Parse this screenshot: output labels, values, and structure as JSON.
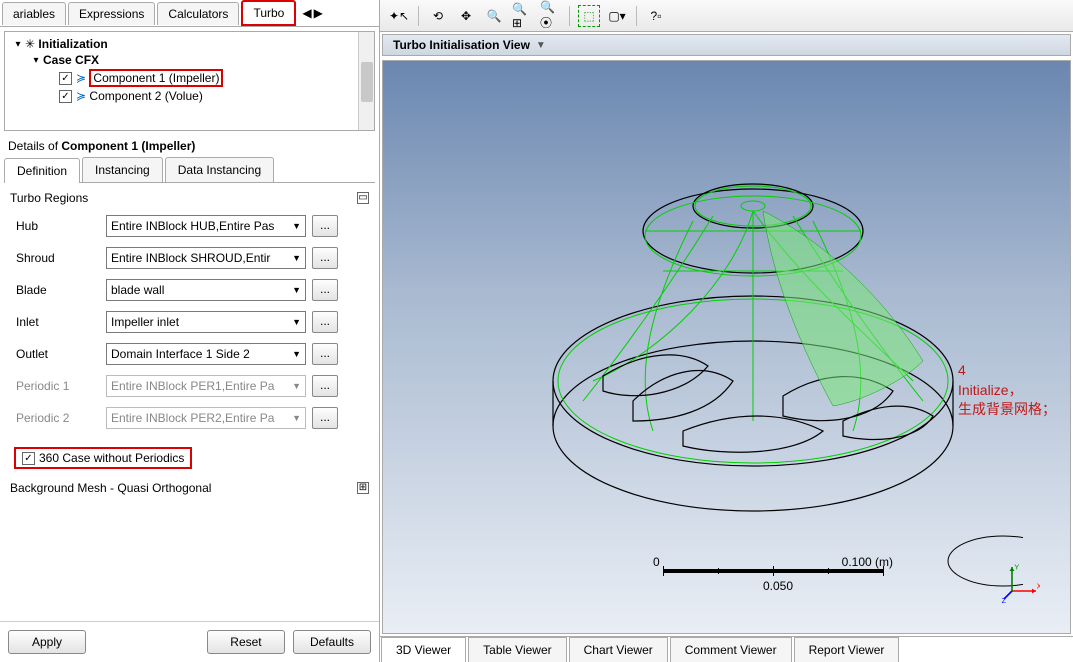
{
  "top_tabs": {
    "t0": "ariables",
    "t1": "Expressions",
    "t2": "Calculators",
    "t3": "Turbo"
  },
  "tree": {
    "root": "Initialization",
    "case": "Case CFX",
    "comp1": "Component 1 (Impeller)",
    "comp2": "Component 2 (Volue)"
  },
  "details": {
    "prefix": "Details of ",
    "item": "Component 1 (Impeller)"
  },
  "sub_tabs": {
    "t0": "Definition",
    "t1": "Instancing",
    "t2": "Data Instancing"
  },
  "group1": "Turbo Regions",
  "rows": {
    "hub": {
      "label": "Hub",
      "value": "Entire INBlock HUB,Entire Pas"
    },
    "shroud": {
      "label": "Shroud",
      "value": "Entire INBlock SHROUD,Entir"
    },
    "blade": {
      "label": "Blade",
      "value": "blade wall"
    },
    "inlet": {
      "label": "Inlet",
      "value": "Impeller inlet"
    },
    "outlet": {
      "label": "Outlet",
      "value": "Domain Interface 1 Side 2"
    },
    "per1": {
      "label": "Periodic 1",
      "value": "Entire INBlock PER1,Entire Pa"
    },
    "per2": {
      "label": "Periodic 2",
      "value": "Entire INBlock PER2,Entire Pa"
    }
  },
  "chk360": "360 Case without Periodics",
  "group2": "Background Mesh - Quasi Orthogonal",
  "buttons": {
    "apply": "Apply",
    "reset": "Reset",
    "defaults": "Defaults"
  },
  "view_title": "Turbo Initialisation View",
  "scale": {
    "left": "0",
    "right": "0.100 (m)",
    "mid": "0.050"
  },
  "annotation": {
    "num": "4",
    "line1": "Initialize，",
    "line2": "生成背景网格；"
  },
  "axes": {
    "x": "X",
    "y": "Y",
    "z": "Z"
  },
  "bottom_tabs": {
    "t0": "3D Viewer",
    "t1": "Table Viewer",
    "t2": "Chart Viewer",
    "t3": "Comment Viewer",
    "t4": "Report Viewer"
  },
  "dots": "..."
}
